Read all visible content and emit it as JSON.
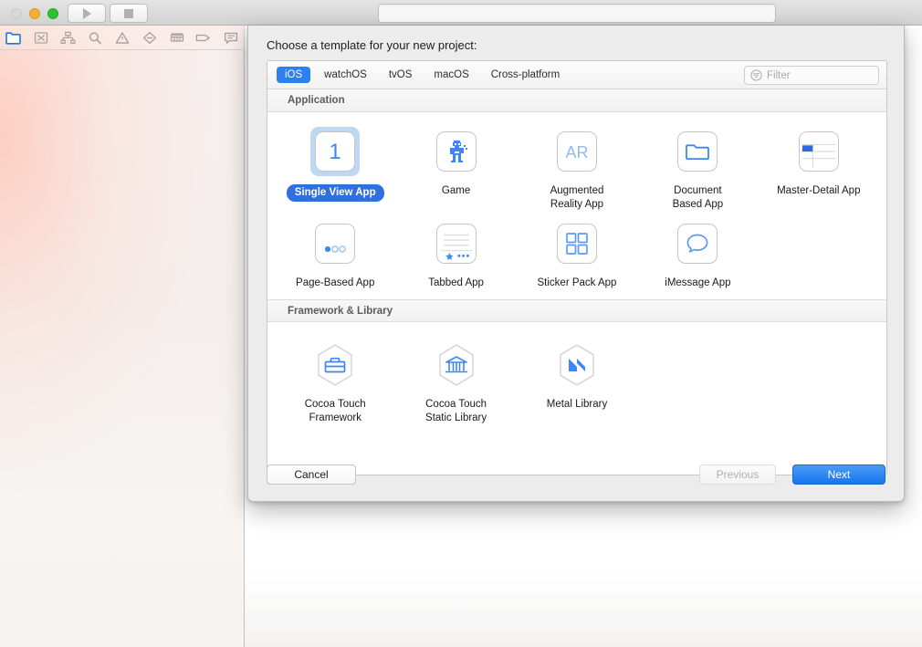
{
  "window": {
    "traffic_lights": [
      "close",
      "minimize",
      "zoom"
    ],
    "run_button_icon": "play-icon",
    "stop_button_icon": "stop-icon",
    "status_field_value": "",
    "accent_blue": "#2f7ff0",
    "selection_pill": "#2f6fe0",
    "selection_highlight": "#bed7f3"
  },
  "navigator": {
    "icons": [
      {
        "name": "project-navigator-icon",
        "active": true
      },
      {
        "name": "source-control-navigator-icon",
        "active": false
      },
      {
        "name": "symbol-navigator-icon",
        "active": false
      },
      {
        "name": "find-navigator-icon",
        "active": false
      },
      {
        "name": "issue-navigator-icon",
        "active": false
      },
      {
        "name": "test-navigator-icon",
        "active": false
      },
      {
        "name": "debug-navigator-icon",
        "active": false
      },
      {
        "name": "breakpoint-navigator-icon",
        "active": false
      },
      {
        "name": "report-navigator-icon",
        "active": false
      }
    ]
  },
  "dialog": {
    "title": "Choose a template for your new project:",
    "platforms": [
      {
        "label": "iOS",
        "selected": true
      },
      {
        "label": "watchOS",
        "selected": false
      },
      {
        "label": "tvOS",
        "selected": false
      },
      {
        "label": "macOS",
        "selected": false
      },
      {
        "label": "Cross-platform",
        "selected": false
      }
    ],
    "filter": {
      "placeholder": "Filter",
      "value": "",
      "icon": "filter-icon"
    },
    "sections": [
      {
        "header": "Application",
        "templates": [
          {
            "label": "Single View App",
            "icon": "single-view-app-icon",
            "selected": true
          },
          {
            "label": "Game",
            "icon": "game-icon",
            "selected": false
          },
          {
            "label": "Augmented\nReality App",
            "icon": "augmented-reality-app-icon",
            "selected": false
          },
          {
            "label": "Document\nBased App",
            "icon": "document-based-app-icon",
            "selected": false
          },
          {
            "label": "Master-Detail App",
            "icon": "master-detail-app-icon",
            "selected": false
          },
          {
            "label": "Page-Based App",
            "icon": "page-based-app-icon",
            "selected": false
          },
          {
            "label": "Tabbed App",
            "icon": "tabbed-app-icon",
            "selected": false
          },
          {
            "label": "Sticker Pack App",
            "icon": "sticker-pack-app-icon",
            "selected": false
          },
          {
            "label": "iMessage App",
            "icon": "imessage-app-icon",
            "selected": false
          }
        ]
      },
      {
        "header": "Framework & Library",
        "templates": [
          {
            "label": "Cocoa Touch\nFramework",
            "icon": "cocoa-touch-framework-icon",
            "selected": false
          },
          {
            "label": "Cocoa Touch\nStatic Library",
            "icon": "cocoa-touch-static-library-icon",
            "selected": false
          },
          {
            "label": "Metal Library",
            "icon": "metal-library-icon",
            "selected": false
          }
        ]
      }
    ],
    "buttons": {
      "cancel": "Cancel",
      "previous": "Previous",
      "next": "Next",
      "previous_disabled": true
    }
  }
}
